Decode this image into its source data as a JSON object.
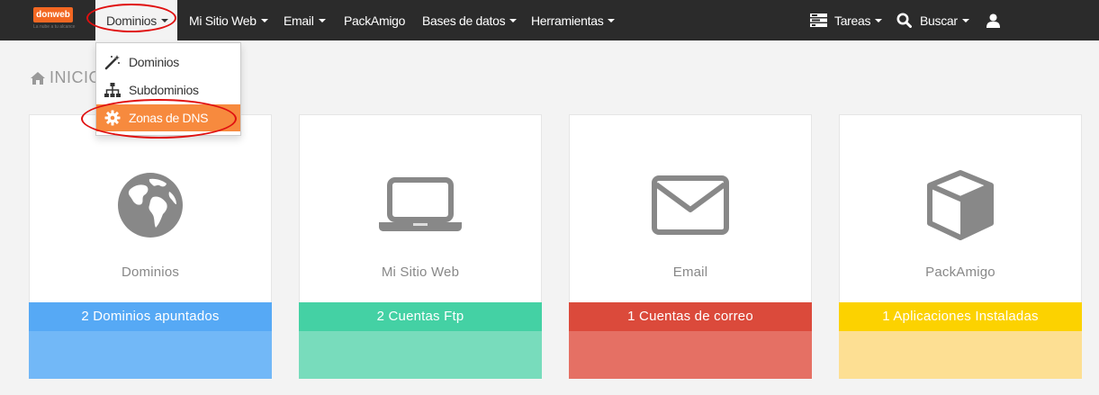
{
  "navbar": {
    "logo_text": "donweb",
    "logo_tagline": "La nube a tu alcance",
    "items": [
      {
        "label": "Dominios"
      },
      {
        "label": "Mi Sitio Web"
      },
      {
        "label": "Email"
      },
      {
        "label": "PackAmigo"
      },
      {
        "label": "Bases de datos"
      },
      {
        "label": "Herramientas"
      }
    ],
    "right": {
      "tasks_label": "Tareas",
      "search_label": "Buscar"
    }
  },
  "dropdown": {
    "items": [
      {
        "label": "Dominios",
        "icon": "magic-wand-icon"
      },
      {
        "label": "Subdominios",
        "icon": "sitemap-icon"
      },
      {
        "label": "Zonas de DNS",
        "icon": "gear-icon"
      }
    ]
  },
  "breadcrumb": {
    "label": "INICIO"
  },
  "cards": [
    {
      "title": "Dominios",
      "status": "2 Dominios apuntados",
      "icon": "globe-icon",
      "bar_color": "#56a9f5",
      "foot_color": "#72b8f7"
    },
    {
      "title": "Mi Sitio Web",
      "status": "2 Cuentas Ftp",
      "icon": "laptop-icon",
      "bar_color": "#44d1a4",
      "foot_color": "#78dcbc"
    },
    {
      "title": "Email",
      "status": "1 Cuentas de correo",
      "icon": "envelope-icon",
      "bar_color": "#db4a3b",
      "foot_color": "#e57064"
    },
    {
      "title": "PackAmigo",
      "status": "1 Aplicaciones Instaladas",
      "icon": "cube-icon",
      "bar_color": "#fcd200",
      "foot_color": "#fddf93"
    }
  ],
  "colors": {
    "navbar_bg": "#2b2b2b",
    "accent_orange": "#f78a3e",
    "highlight_red": "#e01010"
  }
}
